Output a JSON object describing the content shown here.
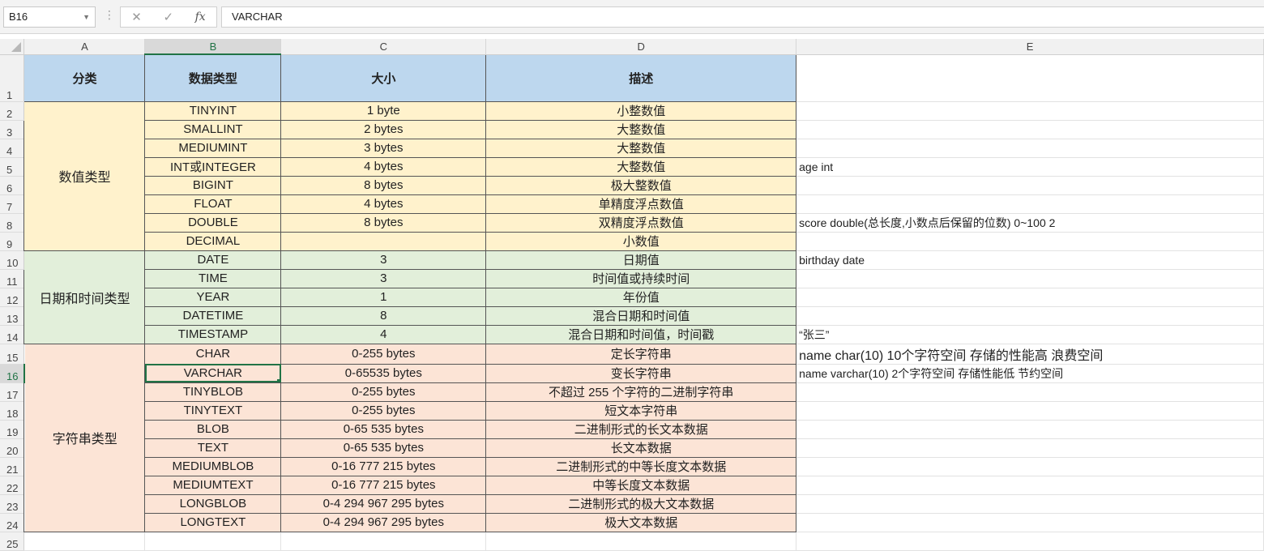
{
  "formula_bar": {
    "name_box": "B16",
    "cancel_icon": "✕",
    "confirm_icon": "✓",
    "fx_label": "fx",
    "formula": "VARCHAR"
  },
  "columns": [
    "A",
    "B",
    "C",
    "D",
    "E"
  ],
  "row_numbers": [
    "1",
    "2",
    "3",
    "4",
    "5",
    "6",
    "7",
    "8",
    "9",
    "10",
    "11",
    "12",
    "13",
    "14",
    "15",
    "16",
    "17",
    "18",
    "19",
    "20",
    "21",
    "22",
    "23",
    "24",
    "25"
  ],
  "headers": {
    "category": "分类",
    "type": "数据类型",
    "size": "大小",
    "desc": "描述"
  },
  "categories": {
    "numeric": "数值类型",
    "datetime": "日期和时间类型",
    "string": "字符串类型"
  },
  "rows": [
    {
      "type": "TINYINT",
      "size": "1 byte",
      "desc": "小整数值",
      "note": ""
    },
    {
      "type": "SMALLINT",
      "size": "2 bytes",
      "desc": "大整数值",
      "note": ""
    },
    {
      "type": "MEDIUMINT",
      "size": "3 bytes",
      "desc": "大整数值",
      "note": ""
    },
    {
      "type": "INT或INTEGER",
      "size": "4 bytes",
      "desc": "大整数值",
      "note": "age int"
    },
    {
      "type": "BIGINT",
      "size": "8 bytes",
      "desc": "极大整数值",
      "note": ""
    },
    {
      "type": "FLOAT",
      "size": "4 bytes",
      "desc": "单精度浮点数值",
      "note": ""
    },
    {
      "type": "DOUBLE",
      "size": "8 bytes",
      "desc": "双精度浮点数值",
      "note": "score double(总长度,小数点后保留的位数)  0~100 2"
    },
    {
      "type": "DECIMAL",
      "size": "",
      "desc": "小数值",
      "note": ""
    },
    {
      "type": "DATE",
      "size": "3",
      "desc": "日期值",
      "note": "birthday date"
    },
    {
      "type": "TIME",
      "size": "3",
      "desc": "时间值或持续时间",
      "note": ""
    },
    {
      "type": "YEAR",
      "size": "1",
      "desc": "年份值",
      "note": ""
    },
    {
      "type": "DATETIME",
      "size": "8",
      "desc": "混合日期和时间值",
      "note": ""
    },
    {
      "type": "TIMESTAMP",
      "size": "4",
      "desc": "混合日期和时间值，时间戳",
      "note": "“张三”"
    },
    {
      "type": "CHAR",
      "size": "0-255 bytes",
      "desc": "定长字符串",
      "note": "name char(10)    10个字符空间     存储的性能高  浪费空间"
    },
    {
      "type": "VARCHAR",
      "size": "0-65535 bytes",
      "desc": "变长字符串",
      "note": "name varchar(10)   2个字符空间      存储性能低  节约空间"
    },
    {
      "type": "TINYBLOB",
      "size": "0-255 bytes",
      "desc": "不超过 255 个字符的二进制字符串",
      "note": ""
    },
    {
      "type": "TINYTEXT",
      "size": "0-255 bytes",
      "desc": "短文本字符串",
      "note": ""
    },
    {
      "type": "BLOB",
      "size": "0-65 535 bytes",
      "desc": "二进制形式的长文本数据",
      "note": ""
    },
    {
      "type": "TEXT",
      "size": "0-65 535 bytes",
      "desc": "长文本数据",
      "note": ""
    },
    {
      "type": "MEDIUMBLOB",
      "size": "0-16 777 215 bytes",
      "desc": "二进制形式的中等长度文本数据",
      "note": ""
    },
    {
      "type": "MEDIUMTEXT",
      "size": "0-16 777 215 bytes",
      "desc": "中等长度文本数据",
      "note": ""
    },
    {
      "type": "LONGBLOB",
      "size": "0-4 294 967 295 bytes",
      "desc": "二进制形式的极大文本数据",
      "note": ""
    },
    {
      "type": "LONGTEXT",
      "size": "0-4 294 967 295 bytes",
      "desc": "极大文本数据",
      "note": ""
    }
  ],
  "colors": {
    "header_fill": "#bdd7ee",
    "numeric_fill": "#fff2cc",
    "datetime_fill": "#e2efda",
    "string_fill": "#fce4d6",
    "selection": "#217346"
  }
}
